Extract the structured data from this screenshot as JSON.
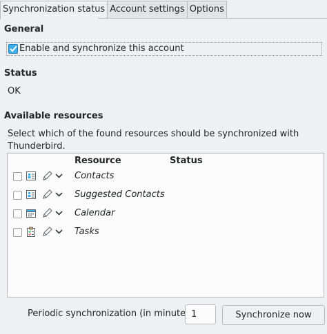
{
  "tabs": [
    {
      "label": "Synchronization status",
      "active": true
    },
    {
      "label": "Account settings",
      "active": false
    },
    {
      "label": "Options",
      "active": false
    }
  ],
  "general": {
    "heading": "General",
    "enable_label": "Enable and synchronize this account",
    "enable_checked": true
  },
  "status": {
    "heading": "Status",
    "value": "OK"
  },
  "resources": {
    "heading": "Available resources",
    "description_line1": "Select which of the found resources should be synchronized with",
    "description_line2": "Thunderbird.",
    "columns": {
      "resource": "Resource",
      "status": "Status"
    },
    "rows": [
      {
        "name": "Contacts",
        "icon": "address-book-icon",
        "checked": false,
        "status": ""
      },
      {
        "name": "Suggested Contacts",
        "icon": "address-book-icon",
        "checked": false,
        "status": ""
      },
      {
        "name": "Calendar",
        "icon": "calendar-icon",
        "checked": false,
        "status": ""
      },
      {
        "name": "Tasks",
        "icon": "task-list-icon",
        "checked": false,
        "status": ""
      }
    ]
  },
  "footer": {
    "interval_label": "Periodic synchronization (in minutes)",
    "interval_value": "1",
    "sync_button": "Synchronize now"
  },
  "colors": {
    "background": "#eff0f1",
    "accent": "#3daee9",
    "list_background": "#fcfcfc"
  }
}
